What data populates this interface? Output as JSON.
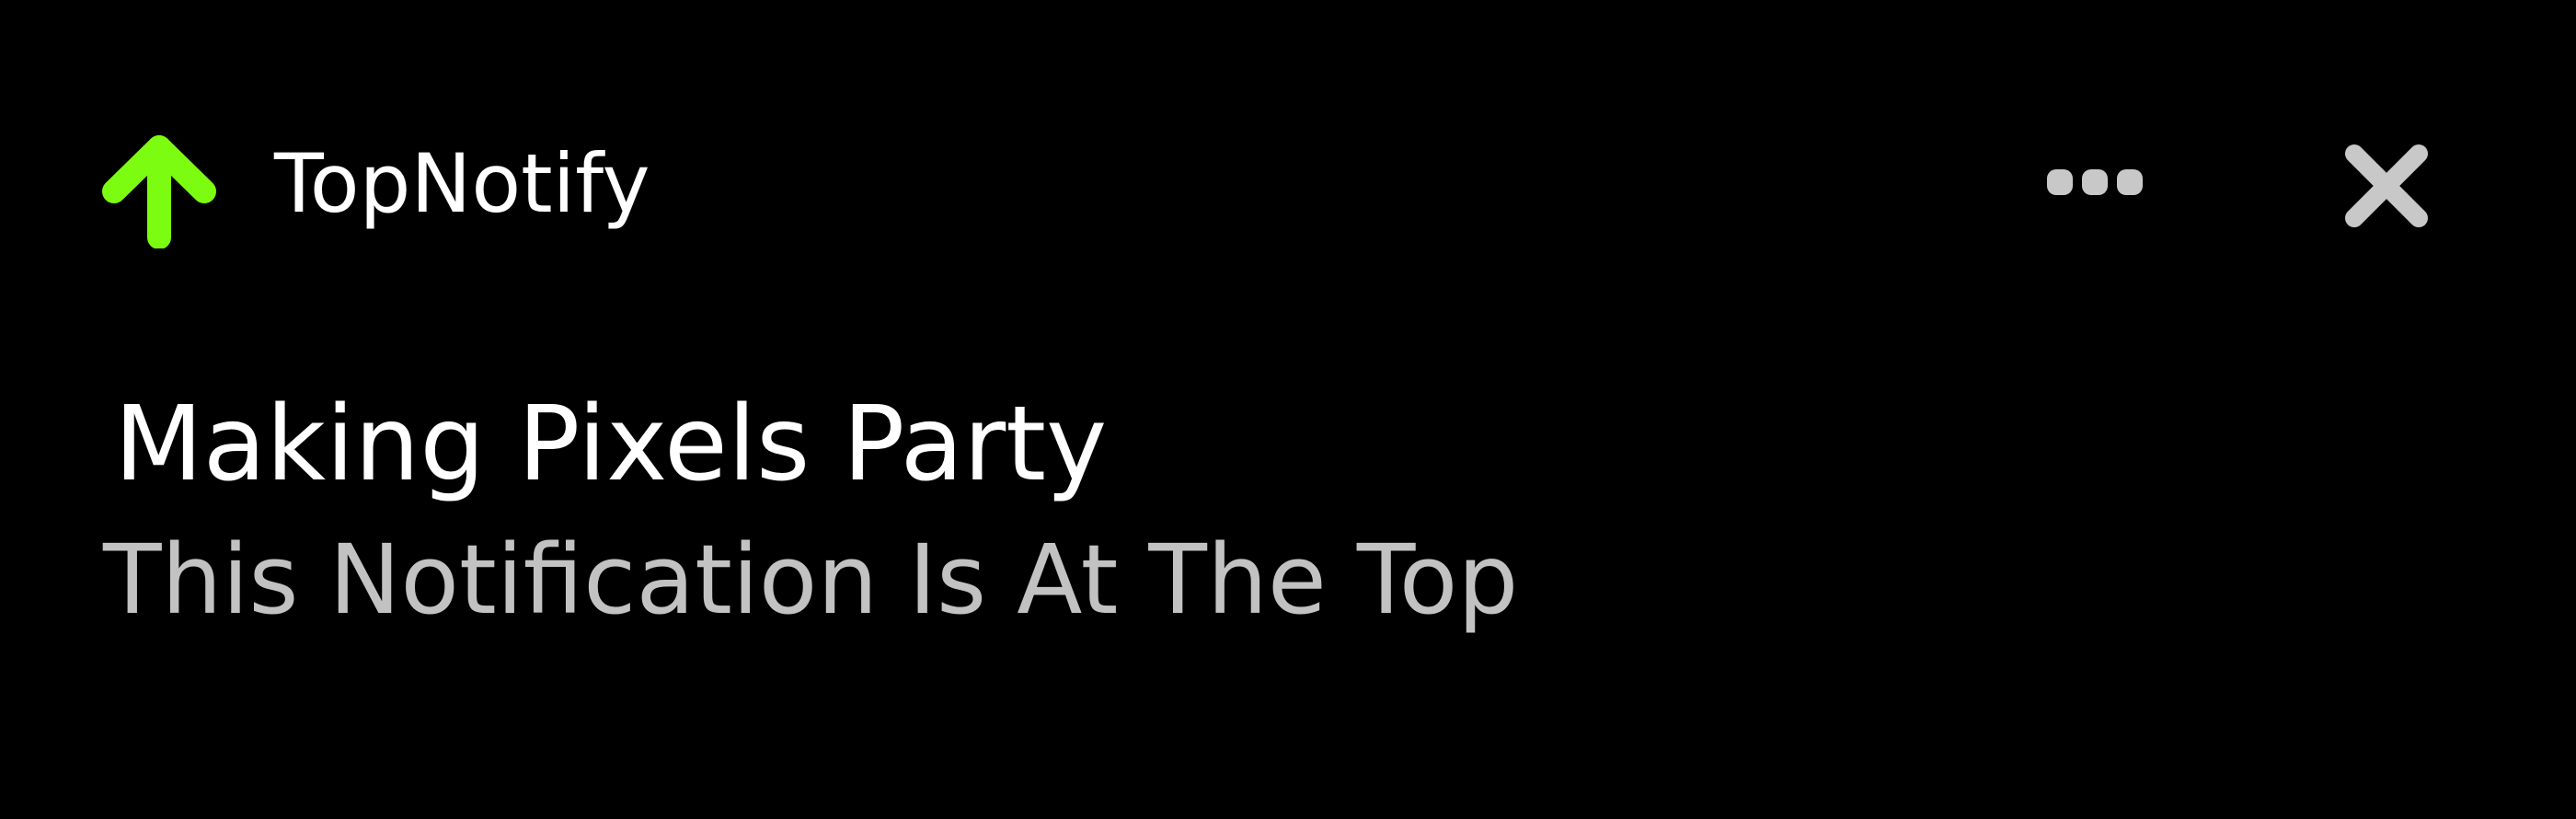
{
  "notification": {
    "app_name": "TopNotify",
    "app_icon": "arrow-up-icon",
    "title": "Making Pixels Party",
    "body": "This Notification Is At The Top",
    "actions": {
      "more_icon": "more-horizontal-icon",
      "close_icon": "close-icon"
    }
  },
  "colors": {
    "background": "#000000",
    "accent": "#7cfc10",
    "title_text": "#ffffff",
    "body_text": "#c2c2c2",
    "icon_gray": "#c8c8c8"
  }
}
